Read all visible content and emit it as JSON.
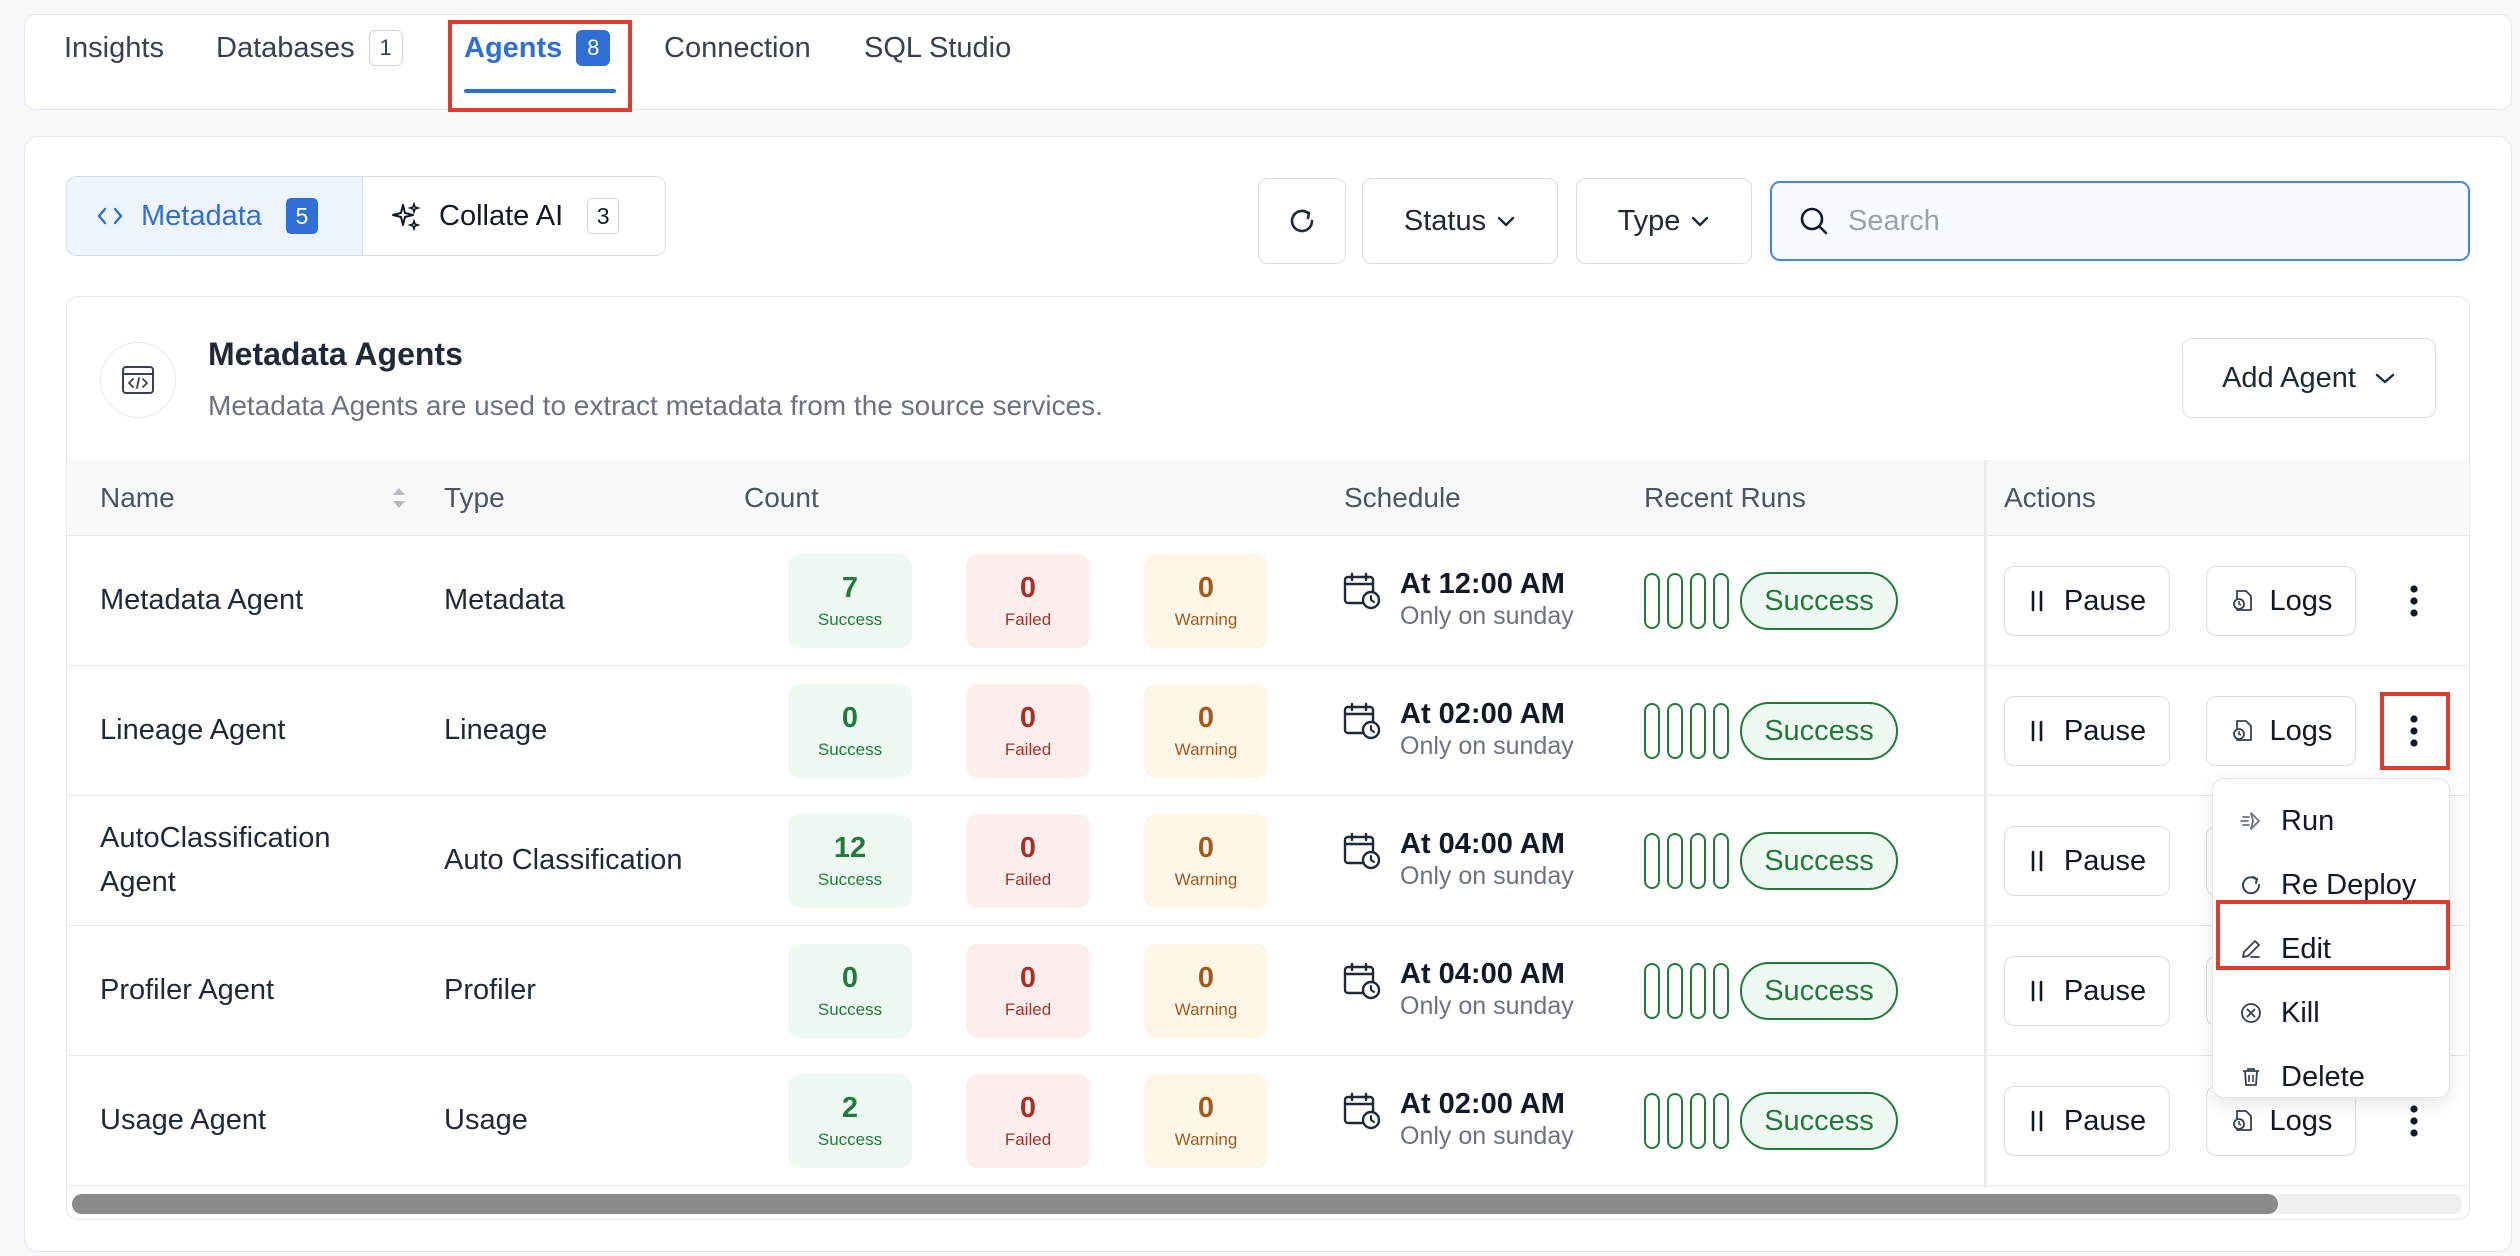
{
  "tabs": [
    {
      "label": "Insights",
      "count": null
    },
    {
      "label": "Databases",
      "count": "1"
    },
    {
      "label": "Agents",
      "count": "8"
    },
    {
      "label": "Connection",
      "count": null
    },
    {
      "label": "SQL Studio",
      "count": null
    }
  ],
  "active_tab": "Agents",
  "segments": [
    {
      "label": "Metadata",
      "count": "5"
    },
    {
      "label": "Collate AI",
      "count": "3"
    }
  ],
  "filters": {
    "status_label": "Status",
    "type_label": "Type"
  },
  "search": {
    "placeholder": "Search",
    "value": ""
  },
  "panel": {
    "title": "Metadata Agents",
    "description": "Metadata Agents are used to extract metadata from the source services.",
    "add_label": "Add Agent"
  },
  "columns": {
    "name": "Name",
    "type": "Type",
    "count": "Count",
    "schedule": "Schedule",
    "recent_runs": "Recent Runs",
    "actions": "Actions"
  },
  "count_labels": {
    "success": "Success",
    "failed": "Failed",
    "warning": "Warning"
  },
  "rows": [
    {
      "name": "Metadata Agent",
      "type": "Metadata",
      "success": "7",
      "failed": "0",
      "warning": "0",
      "time": "At 12:00 AM",
      "freq": "Only on sunday",
      "status": "Success"
    },
    {
      "name": "Lineage Agent",
      "type": "Lineage",
      "success": "0",
      "failed": "0",
      "warning": "0",
      "time": "At 02:00 AM",
      "freq": "Only on sunday",
      "status": "Success"
    },
    {
      "name": "AutoClassification Agent",
      "type": "Auto Classification",
      "success": "12",
      "failed": "0",
      "warning": "0",
      "time": "At 04:00 AM",
      "freq": "Only on sunday",
      "status": "Success"
    },
    {
      "name": "Profiler Agent",
      "type": "Profiler",
      "success": "0",
      "failed": "0",
      "warning": "0",
      "time": "At 04:00 AM",
      "freq": "Only on sunday",
      "status": "Success"
    },
    {
      "name": "Usage Agent",
      "type": "Usage",
      "success": "2",
      "failed": "0",
      "warning": "0",
      "time": "At 02:00 AM",
      "freq": "Only on sunday",
      "status": "Success"
    }
  ],
  "actions": {
    "pause": "Pause",
    "logs": "Logs"
  },
  "menu": [
    {
      "label": "Run",
      "icon": "run-icon"
    },
    {
      "label": "Re Deploy",
      "icon": "redeploy-icon"
    },
    {
      "label": "Edit",
      "icon": "edit-icon"
    },
    {
      "label": "Kill",
      "icon": "kill-icon"
    },
    {
      "label": "Delete",
      "icon": "delete-icon"
    }
  ],
  "colors": {
    "accent": "#2f6fd6",
    "success": "#237a3b",
    "failed": "#a8322a",
    "warning": "#a6581c",
    "highlight": "#e23b2e"
  }
}
